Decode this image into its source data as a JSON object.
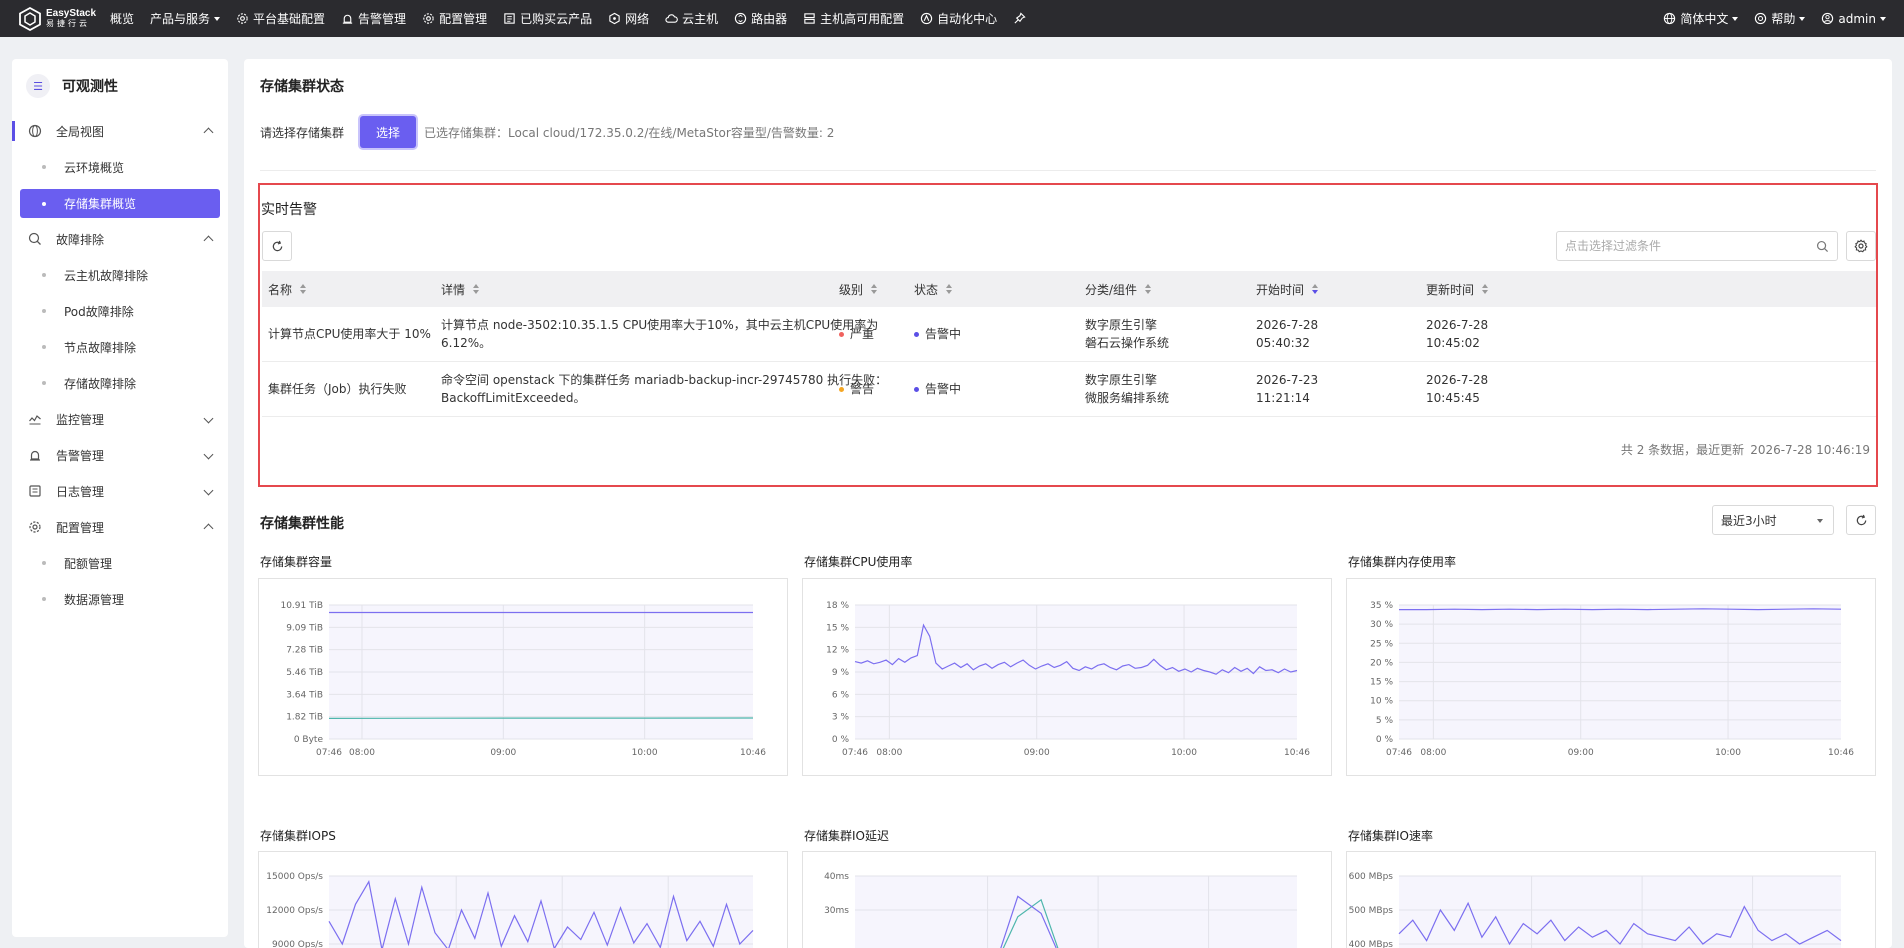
{
  "brand": {
    "name_en": "EasyStack",
    "name_cn": "易捷行云"
  },
  "topnav": {
    "items": [
      {
        "label": "概览",
        "icon": "",
        "caret": false
      },
      {
        "label": "产品与服务",
        "icon": "",
        "caret": true
      },
      {
        "label": "平台基础配置",
        "icon": "gear-icon",
        "caret": false
      },
      {
        "label": "告警管理",
        "icon": "alarm-icon",
        "caret": false
      },
      {
        "label": "配置管理",
        "icon": "gear-icon",
        "caret": false
      },
      {
        "label": "已购买云产品",
        "icon": "document-icon",
        "caret": false
      },
      {
        "label": "网络",
        "icon": "network-icon",
        "caret": false
      },
      {
        "label": "云主机",
        "icon": "cloud-icon",
        "caret": false
      },
      {
        "label": "路由器",
        "icon": "router-icon",
        "caret": false
      },
      {
        "label": "主机高可用配置",
        "icon": "server-icon",
        "caret": false
      },
      {
        "label": "自动化中心",
        "icon": "automation-icon",
        "caret": false
      },
      {
        "label": "",
        "icon": "pin-icon",
        "caret": false
      }
    ],
    "language": "简体中文",
    "help": "帮助",
    "user": "admin"
  },
  "sidebar": {
    "title": "可观测性",
    "groups": [
      {
        "label": "全局视图",
        "expanded": true,
        "items": [
          "云环境概览",
          "存储集群概览"
        ]
      },
      {
        "label": "故障排除",
        "expanded": true,
        "items": [
          "云主机故障排除",
          "Pod故障排除",
          "节点故障排除",
          "存储故障排除"
        ]
      },
      {
        "label": "监控管理",
        "expanded": false,
        "items": []
      },
      {
        "label": "告警管理",
        "expanded": false,
        "items": []
      },
      {
        "label": "日志管理",
        "expanded": false,
        "items": []
      },
      {
        "label": "配置管理",
        "expanded": true,
        "items": [
          "配额管理",
          "数据源管理"
        ]
      }
    ],
    "active_item": "存储集群概览"
  },
  "cluster": {
    "section_title": "存储集群状态",
    "select_label": "请选择存储集群",
    "select_button": "选择",
    "selected_info": "已选存储集群：Local cloud/172.35.0.2/在线/MetaStor容量型/告警数量: 2"
  },
  "alerts": {
    "title": "实时告警",
    "filter_placeholder": "点击选择过滤条件",
    "columns": [
      "名称",
      "详情",
      "级别",
      "状态",
      "分类/组件",
      "开始时间",
      "更新时间"
    ],
    "rows": [
      {
        "name": "计算节点CPU使用率大于 10%",
        "detail": "计算节点 node-3502:10.35.1.5 CPU使用率大于10%，其中云主机CPU使用率为6.12%。",
        "level": "严重",
        "level_color": "#f0625e",
        "status": "告警中",
        "status_color": "#5b4fe6",
        "category": "数字原生引擎",
        "component": "磐石云操作系统",
        "start_date": "2026-7-28",
        "start_time": "05:40:32",
        "update_date": "2026-7-28",
        "update_time": "10:45:02"
      },
      {
        "name": "集群任务（Job）执行失败",
        "detail": "命令空间 openstack 下的集群任务 mariadb-backup-incr-29745780 执行失败：BackoffLimitExceeded。",
        "level": "警告",
        "level_color": "#f5a623",
        "status": "告警中",
        "status_color": "#5b4fe6",
        "category": "数字原生引擎",
        "component": "微服务编排系统",
        "start_date": "2026-7-23",
        "start_time": "11:21:14",
        "update_date": "2026-7-28",
        "update_time": "10:45:45"
      }
    ],
    "footer_count": "共 2 条数据，最近更新",
    "footer_time": "2026-7-28 10:46:19"
  },
  "performance": {
    "title": "存储集群性能",
    "range": "最近3小时"
  },
  "chart_data": [
    {
      "type": "line",
      "title": "存储集群容量",
      "x_ticks": [
        "07:46",
        "08:00",
        "09:00",
        "10:00",
        "10:46"
      ],
      "y_ticks": [
        "0 Byte",
        "1.82 TiB",
        "3.64 TiB",
        "5.46 TiB",
        "7.28 TiB",
        "9.09 TiB",
        "10.91 TiB"
      ],
      "ylim_tib": [
        0,
        10.91
      ],
      "series": [
        {
          "color": "#7c6ff0",
          "values": [
            10.3,
            10.3,
            10.3,
            10.3,
            10.3
          ]
        },
        {
          "color": "#4db6ac",
          "values": [
            1.68,
            1.69,
            1.7,
            1.7,
            1.71
          ]
        }
      ]
    },
    {
      "type": "line",
      "title": "存储集群CPU使用率",
      "x_ticks": [
        "07:46",
        "08:00",
        "09:00",
        "10:00",
        "10:46"
      ],
      "y_ticks": [
        "0 %",
        "3 %",
        "6 %",
        "9 %",
        "12 %",
        "15 %",
        "18 %"
      ],
      "ylim": [
        0,
        18
      ],
      "series": [
        {
          "color": "#7c6ff0",
          "values": [
            10.4,
            10.2,
            10.5,
            10.1,
            10.3,
            10.6,
            10.0,
            10.8,
            10.3,
            10.9,
            11.2,
            15.3,
            13.8,
            10.2,
            9.4,
            9.8,
            10.2,
            9.6,
            10.1,
            9.3,
            9.8,
            10.1,
            9.5,
            10.0,
            10.3,
            9.7,
            10.2,
            10.6,
            9.9,
            9.4,
            9.8,
            10.1,
            9.6,
            9.9,
            10.4,
            9.5,
            9.2,
            9.7,
            9.4,
            9.9,
            10.1,
            9.6,
            9.3,
            9.8,
            10.0,
            9.5,
            9.6,
            9.9,
            10.7,
            9.9,
            9.3,
            9.6,
            9.1,
            9.4,
            9.0,
            9.5,
            9.2,
            9.0,
            8.7,
            9.3,
            8.9,
            9.6,
            9.1,
            9.5,
            8.8,
            9.7,
            9.2,
            9.3,
            8.9,
            9.4,
            9.0,
            9.2
          ]
        }
      ]
    },
    {
      "type": "line",
      "title": "存储集群内存使用率",
      "x_ticks": [
        "07:46",
        "08:00",
        "09:00",
        "10:00",
        "10:46"
      ],
      "y_ticks": [
        "0 %",
        "5 %",
        "10 %",
        "15 %",
        "20 %",
        "25 %",
        "30 %",
        "35 %"
      ],
      "ylim": [
        0,
        35
      ],
      "series": [
        {
          "color": "#7c6ff0",
          "values": [
            33.8,
            33.8,
            33.9,
            33.8,
            33.9,
            33.8,
            33.9,
            33.8,
            33.9,
            33.8,
            33.9,
            34.0,
            33.9,
            33.8,
            33.9,
            34.0,
            33.9
          ]
        }
      ]
    },
    {
      "type": "line",
      "title": "存储集群IOPS",
      "y_ticks": [
        "9000 Ops/s",
        "12000 Ops/s",
        "15000 Ops/s"
      ],
      "series": [
        {
          "color": "#7c6ff0",
          "values": [
            11000,
            9000,
            12500,
            14500,
            8500,
            13000,
            9000,
            14000,
            10000,
            8500,
            12000,
            9500,
            13500,
            8800,
            11500,
            9200,
            12800,
            8600,
            10500,
            9400,
            11800,
            8900,
            12200,
            9100,
            10800,
            8700,
            13200,
            9300,
            11000,
            8800,
            12500,
            9000,
            10200
          ]
        }
      ]
    },
    {
      "type": "line",
      "title": "存储集群IO延迟",
      "y_ticks": [
        "30ms",
        "40ms"
      ],
      "series": [
        {
          "color": "#4db6ac",
          "values": [
            0,
            0,
            0,
            0,
            0,
            0,
            0,
            28,
            33,
            0,
            0,
            0,
            0,
            0,
            0,
            0,
            0,
            0,
            0,
            0
          ]
        },
        {
          "color": "#7c6ff0",
          "values": [
            0,
            0,
            0,
            0,
            0,
            0,
            0,
            34,
            29,
            0,
            0,
            0,
            0,
            0,
            0,
            0,
            0,
            0,
            0,
            0
          ]
        }
      ]
    },
    {
      "type": "line",
      "title": "存储集群IO速率",
      "y_ticks": [
        "400 MBps",
        "500 MBps",
        "600 MBps"
      ],
      "series": [
        {
          "color": "#7c6ff0",
          "values": [
            430,
            470,
            410,
            500,
            440,
            520,
            420,
            480,
            400,
            460,
            430,
            470,
            410,
            450,
            420,
            440,
            400,
            460,
            430,
            420,
            410,
            450,
            400,
            430,
            420,
            510,
            440,
            410,
            430,
            400,
            420,
            440,
            410
          ]
        }
      ]
    }
  ]
}
